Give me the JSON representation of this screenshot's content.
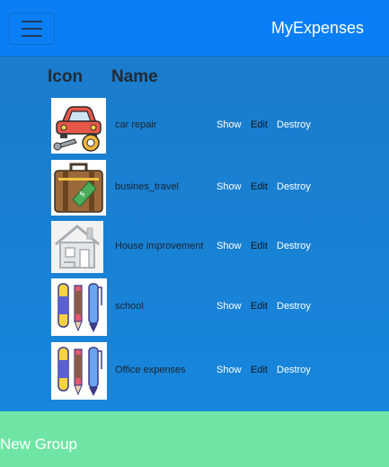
{
  "navbar": {
    "brand": "MyExpenses",
    "toggler_icon": "hamburger-menu-icon",
    "background": "#0a7ff5"
  },
  "table": {
    "headers": {
      "icon": "Icon",
      "name": "Name"
    },
    "rows": [
      {
        "name": "car repair",
        "icon": "car-repair-icon",
        "show": "Show",
        "edit": "Edit",
        "destroy": "Destroy"
      },
      {
        "name": "busines_travel",
        "icon": "suitcase-icon",
        "show": "Show",
        "edit": "Edit",
        "destroy": "Destroy"
      },
      {
        "name": "House improvement",
        "icon": "house-icon",
        "show": "Show",
        "edit": "Edit",
        "destroy": "Destroy"
      },
      {
        "name": "school",
        "icon": "pens-icon",
        "show": "Show",
        "edit": "Edit",
        "destroy": "Destroy"
      },
      {
        "name": "Office expenses",
        "icon": "pens-icon",
        "show": "Show",
        "edit": "Edit",
        "destroy": "Destroy"
      }
    ]
  },
  "footer": {
    "new_group": "New Group",
    "background": "#6ee5a4"
  },
  "colors": {
    "main_background": "#1683d6",
    "link": "#ffffff"
  }
}
